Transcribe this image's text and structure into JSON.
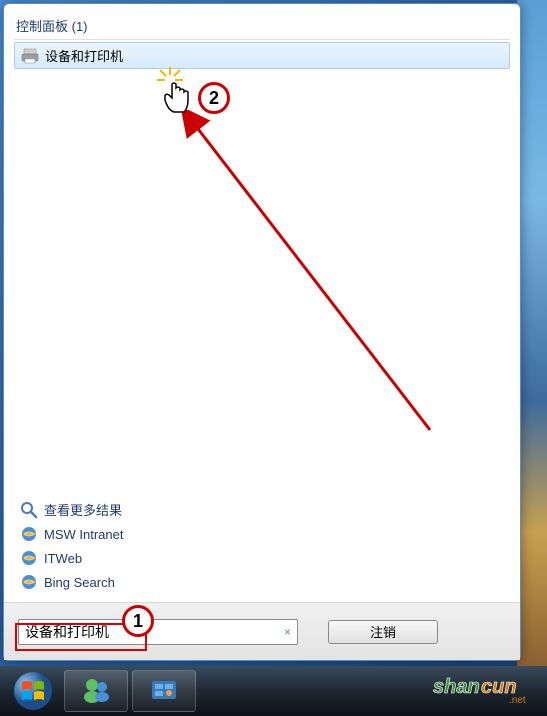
{
  "group": {
    "title": "控制面板 (1)",
    "item": {
      "label": "设备和打印机"
    }
  },
  "links": {
    "more_results": "查看更多结果",
    "intranet": "MSW Intranet",
    "itweb": "ITWeb",
    "bing": "Bing Search"
  },
  "search": {
    "value": "设备和打印机",
    "clear_symbol": "×"
  },
  "logout_label": "注销",
  "annotations": {
    "badge1": "1",
    "badge2": "2"
  },
  "watermark": {
    "part1": "shan",
    "part2": "cun",
    "suffix": ".net"
  }
}
